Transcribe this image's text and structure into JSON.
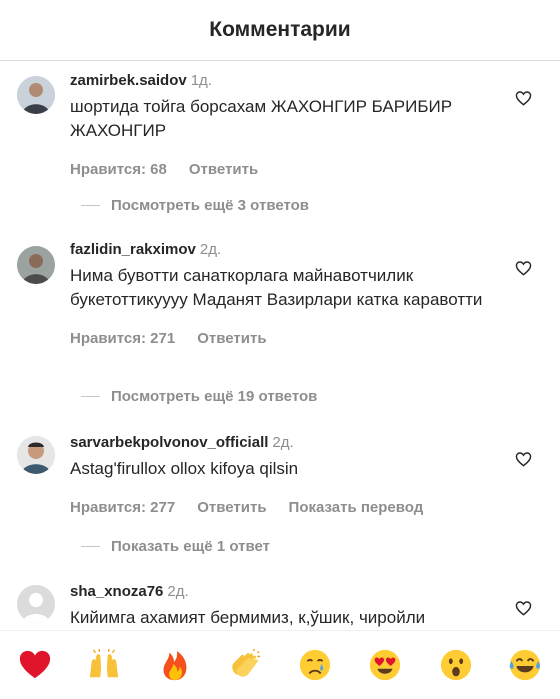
{
  "header": {
    "title": "Комментарии"
  },
  "comments": [
    {
      "username": "zamirbek.saidov",
      "time": "1д.",
      "text": "шортида тойга борсахам ЖАХОНГИР БАРИБИР ЖАХОНГИР",
      "likes": "Нравится: 68",
      "reply": "Ответить",
      "view_replies": "Посмотреть ещё 3 ответов"
    },
    {
      "username": "fazlidin_rakximov",
      "time": "2д.",
      "text": "Нима бувотти санаткорлага майнавотчилик букетоттикуууу Маданят Вазирлари катка каравотти",
      "likes": "Нравится: 271",
      "reply": "Ответить",
      "view_replies": "Посмотреть ещё 19 ответов"
    },
    {
      "username": "sarvarbekpolvonov_officiall",
      "time": "2д.",
      "text": "Astag'firullox ollox kifoya qilsin",
      "likes": "Нравится: 277",
      "reply": "Ответить",
      "translate": "Показать перевод",
      "view_replies": "Показать ещё 1 ответ"
    },
    {
      "username": "sha_xnoza76",
      "time": "2д.",
      "text": "Кийимга ахамият бермимиз, к,ўшик, чиройли"
    }
  ],
  "emoji_bar": [
    "red-heart",
    "raising-hands",
    "fire",
    "clapping-hands",
    "crying-face",
    "heart-eyes-face",
    "surprised-face",
    "tears-of-joy-face"
  ]
}
